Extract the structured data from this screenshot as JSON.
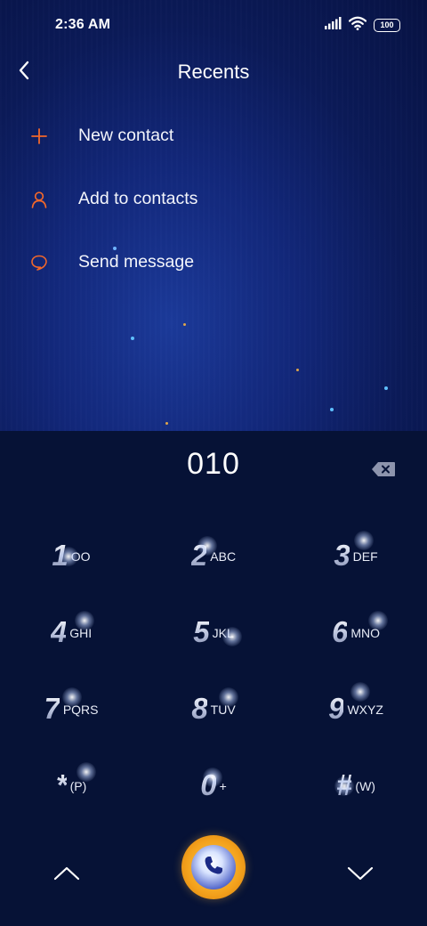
{
  "status_bar": {
    "time": "2:36 AM",
    "battery": "100",
    "icons": [
      "signal-icon",
      "wifi-icon",
      "battery-icon"
    ]
  },
  "header": {
    "title": "Recents",
    "back_icon": "chevron-left-icon"
  },
  "menu": [
    {
      "label": "New contact",
      "icon": "plus-icon"
    },
    {
      "label": "Add to contacts",
      "icon": "person-icon"
    },
    {
      "label": "Send message",
      "icon": "chat-bubble-icon"
    }
  ],
  "dialer": {
    "number": "010",
    "backspace_icon": "backspace-icon",
    "keys": [
      {
        "digit": "1",
        "letters": "OO"
      },
      {
        "digit": "2",
        "letters": "ABC"
      },
      {
        "digit": "3",
        "letters": "DEF"
      },
      {
        "digit": "4",
        "letters": "GHI"
      },
      {
        "digit": "5",
        "letters": "JKL"
      },
      {
        "digit": "6",
        "letters": "MNO"
      },
      {
        "digit": "7",
        "letters": "PQRS"
      },
      {
        "digit": "8",
        "letters": "TUV"
      },
      {
        "digit": "9",
        "letters": "WXYZ"
      },
      {
        "digit": "*",
        "letters": "(P)"
      },
      {
        "digit": "0",
        "letters": "+"
      },
      {
        "digit": "#",
        "letters": "(W)"
      }
    ]
  },
  "bottom_bar": {
    "left_icon": "chevron-up-icon",
    "center_icon": "phone-icon",
    "right_icon": "chevron-down-icon"
  },
  "colors": {
    "accent": "#f2672a",
    "top_background": "#0d1f66",
    "dialer_background": "#061236",
    "call_button": "#f3a11c"
  }
}
